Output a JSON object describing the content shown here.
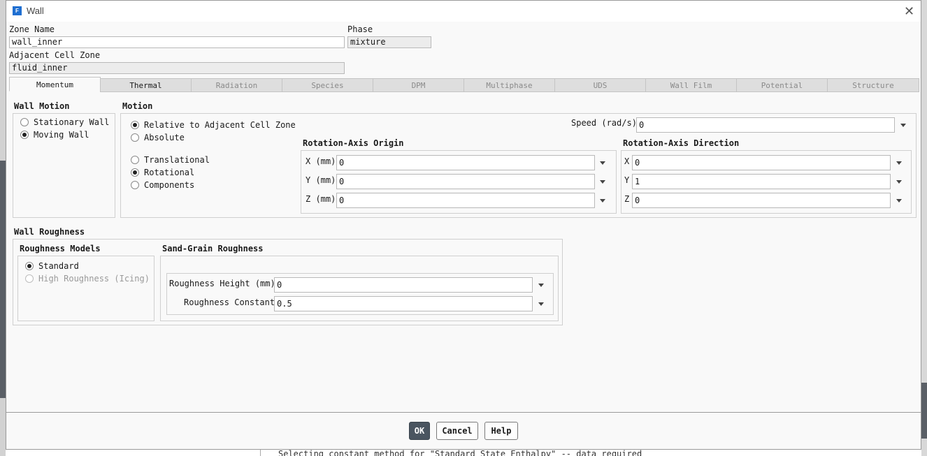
{
  "window": {
    "title": "Wall",
    "app_icon": "F"
  },
  "zone_name": {
    "label": "Zone Name",
    "value": "wall_inner"
  },
  "phase": {
    "label": "Phase",
    "value": "mixture"
  },
  "adjacent_cell_zone": {
    "label": "Adjacent Cell Zone",
    "value": "fluid_inner"
  },
  "tabs": [
    {
      "label": "Momentum",
      "state": "active"
    },
    {
      "label": "Thermal",
      "state": "enabled"
    },
    {
      "label": "Radiation",
      "state": "disabled"
    },
    {
      "label": "Species",
      "state": "disabled"
    },
    {
      "label": "DPM",
      "state": "disabled"
    },
    {
      "label": "Multiphase",
      "state": "disabled"
    },
    {
      "label": "UDS",
      "state": "disabled"
    },
    {
      "label": "Wall Film",
      "state": "disabled"
    },
    {
      "label": "Potential",
      "state": "disabled"
    },
    {
      "label": "Structure",
      "state": "disabled"
    }
  ],
  "wall_motion": {
    "title": "Wall Motion",
    "options": [
      "Stationary Wall",
      "Moving Wall"
    ],
    "selected": "Moving Wall"
  },
  "motion": {
    "title": "Motion",
    "reference": {
      "options": [
        "Relative to Adjacent Cell Zone",
        "Absolute"
      ],
      "selected": "Relative to Adjacent Cell Zone"
    },
    "type": {
      "options": [
        "Translational",
        "Rotational",
        "Components"
      ],
      "selected": "Rotational"
    },
    "speed": {
      "label": "Speed (rad/s)",
      "value": "0"
    },
    "origin": {
      "title": "Rotation-Axis Origin",
      "x_label": "X (mm)",
      "x": "0",
      "y_label": "Y (mm)",
      "y": "0",
      "z_label": "Z (mm)",
      "z": "0"
    },
    "direction": {
      "title": "Rotation-Axis Direction",
      "x_label": "X",
      "x": "0",
      "y_label": "Y",
      "y": "1",
      "z_label": "Z",
      "z": "0"
    }
  },
  "wall_roughness": {
    "title": "Wall Roughness",
    "models": {
      "title": "Roughness Models",
      "options": [
        "Standard",
        "High Roughness (Icing)"
      ],
      "selected": "Standard"
    },
    "sand_grain": {
      "title": "Sand-Grain Roughness",
      "height_label": "Roughness Height (mm)",
      "height": "0",
      "constant_label": "Roughness Constant",
      "constant": "0.5"
    }
  },
  "buttons": {
    "ok": "OK",
    "cancel": "Cancel",
    "help": "Help"
  },
  "background_console": "Selecting constant method for \"Standard State Enthalpy\" -- data required"
}
